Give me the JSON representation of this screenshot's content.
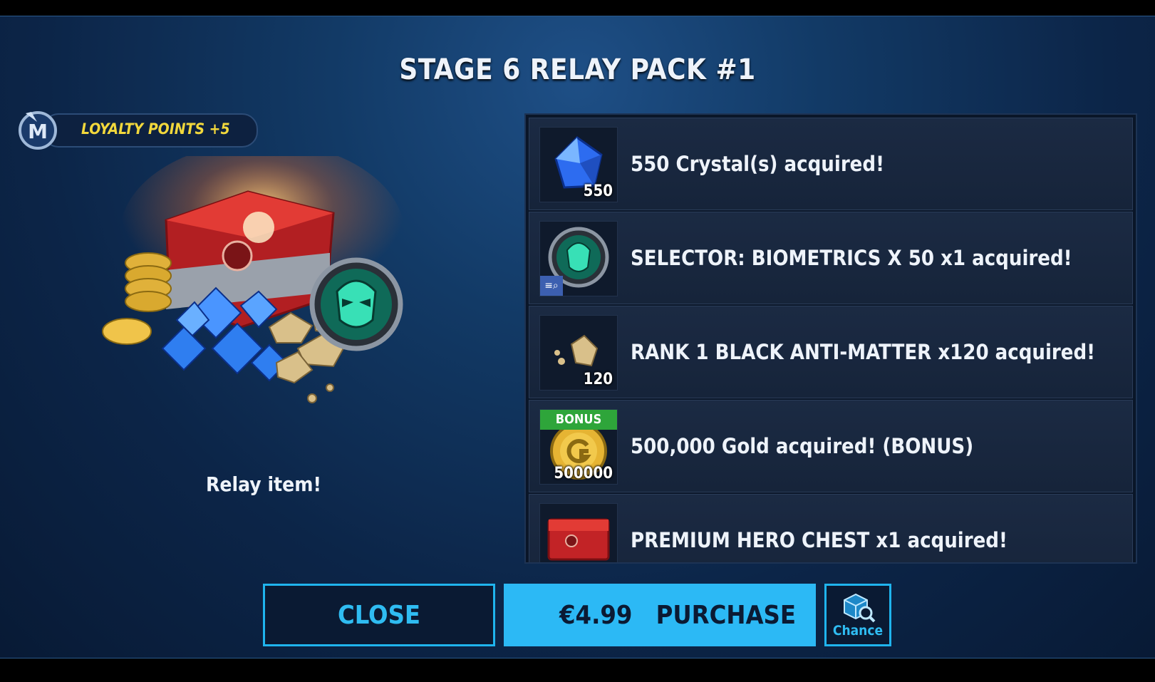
{
  "title": "STAGE 6 RELAY PACK #1",
  "loyalty": {
    "label": "LOYALTY POINTS +5"
  },
  "relay_label": "Relay item!",
  "rewards": [
    {
      "icon": "crystal-icon",
      "qty": "550",
      "text": "550 Crystal(s) acquired!"
    },
    {
      "icon": "biometrics-selector-icon",
      "qty": "",
      "text": "SELECTOR: BIOMETRICS X 50 x1 acquired!"
    },
    {
      "icon": "anti-matter-icon",
      "qty": "120",
      "text": "RANK 1 BLACK ANTI-MATTER x120 acquired!"
    },
    {
      "icon": "gold-icon",
      "qty": "500000",
      "tag": "BONUS",
      "text": "500,000 Gold acquired!  (BONUS)"
    },
    {
      "icon": "hero-chest-icon",
      "qty": "",
      "text": "PREMIUM HERO CHEST x1 acquired!"
    }
  ],
  "buttons": {
    "close": "CLOSE",
    "price": "€4.99",
    "purchase": "PURCHASE",
    "chance": "Chance"
  },
  "colors": {
    "accent": "#2cb9f5",
    "loyalty_text": "#f2d83c",
    "bonus_tag": "#2ea53a"
  }
}
